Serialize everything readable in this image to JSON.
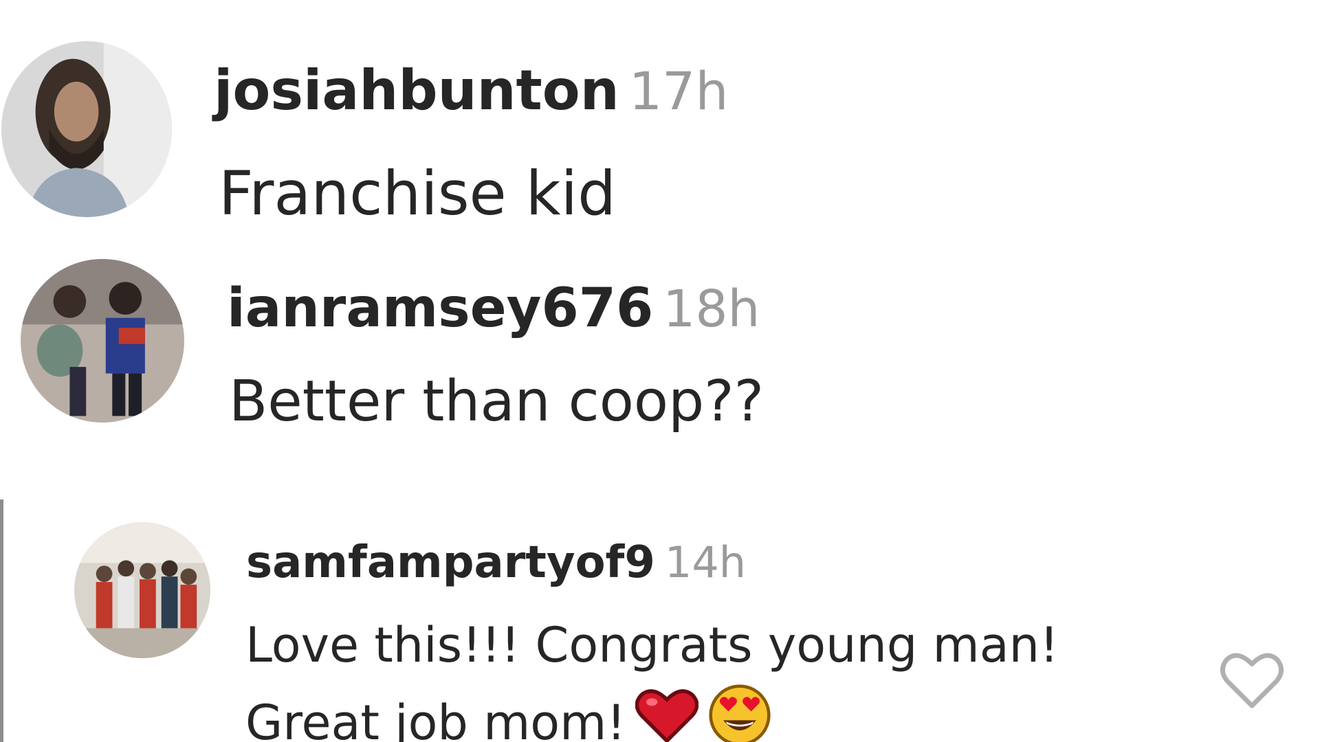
{
  "comments": [
    {
      "username": "josiahbunton",
      "time": "17h",
      "text": "Franchise kid",
      "avatar_icon": "profile-photo-bearded-man"
    },
    {
      "username": "ianramsey676",
      "time": "18h",
      "text": "Better than coop??",
      "avatar_icon": "profile-photo-two-kids"
    },
    {
      "username": "samfampartyof9",
      "time": "14h",
      "text_line1": "Love this!!! Congrats young man!",
      "text_line2": "Great job mom!",
      "emojis": [
        "red-heart-emoji",
        "heart-eyes-emoji"
      ],
      "avatar_icon": "profile-photo-family-group",
      "like_icon": "heart-outline-icon",
      "is_reply": true
    }
  ],
  "colors": {
    "username": "#262626",
    "timestamp": "#9a9a9a",
    "reply_line": "#8e8e8e",
    "like_icon": "#b0b0b0"
  }
}
